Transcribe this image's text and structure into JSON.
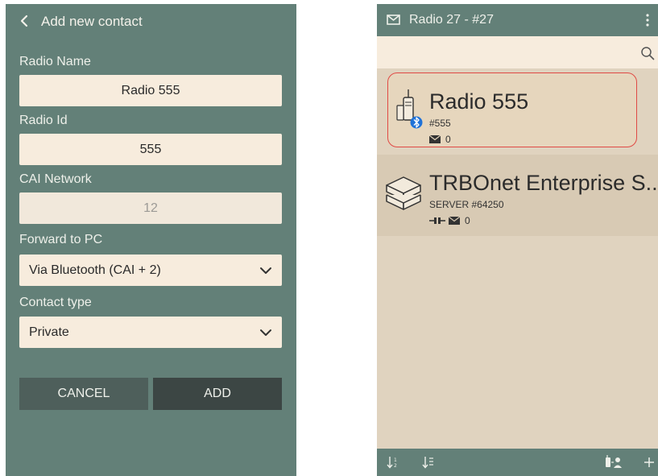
{
  "left_screen": {
    "header": {
      "title": "Add new contact"
    },
    "fields": {
      "radio_name": {
        "label": "Radio Name",
        "value": "Radio 555"
      },
      "radio_id": {
        "label": "Radio Id",
        "value": "555"
      },
      "cai_network": {
        "label": "CAI Network",
        "value": "12"
      },
      "forward_to_pc": {
        "label": "Forward to PC",
        "value": "Via Bluetooth (CAI + 2)"
      },
      "contact_type": {
        "label": "Contact type",
        "value": "Private"
      }
    },
    "buttons": {
      "cancel": "CANCEL",
      "add": "ADD"
    }
  },
  "right_screen": {
    "title": "Radio 27 - #27",
    "contacts": [
      {
        "name": "Radio 555",
        "subtitle": "#555",
        "messages": "0",
        "icon": "radio-bluetooth-icon",
        "selected": true
      },
      {
        "name": "TRBOnet Enterprise S...",
        "subtitle": "SERVER #64250",
        "messages": "0",
        "icon": "server-stack-icon",
        "selected": false
      }
    ]
  },
  "colors": {
    "header_teal": "#638078",
    "field_bg": "#f7ecdd",
    "list_bg": "#e0d3bf",
    "selected_border": "#e04a45",
    "bluetooth_blue": "#1f72d8"
  }
}
